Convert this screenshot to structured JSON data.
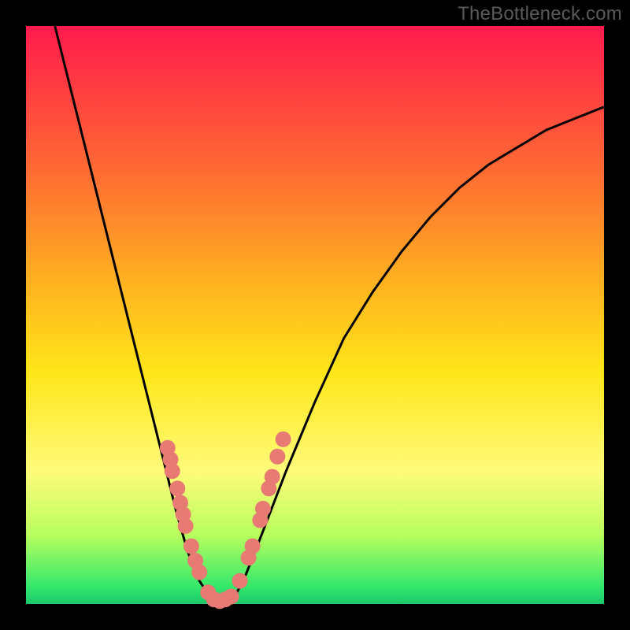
{
  "watermark": "TheBottleneck.com",
  "chart_data": {
    "type": "line",
    "title": "",
    "xlabel": "",
    "ylabel": "",
    "xlim": [
      0,
      100
    ],
    "ylim": [
      0,
      100
    ],
    "annotations": [],
    "curve": {
      "description": "V-shaped bottleneck curve; minimum (optimal match) at roughly x≈33 where y≈0; steep on the left, shallower asymptotic rise on the right",
      "x": [
        5,
        10,
        15,
        20,
        22,
        24,
        26,
        28,
        30,
        32,
        34,
        36,
        38,
        40,
        45,
        50,
        55,
        60,
        65,
        70,
        75,
        80,
        85,
        90,
        95,
        100
      ],
      "y": [
        100,
        80,
        60,
        40,
        32,
        24,
        16,
        9,
        4,
        1,
        0,
        1,
        5,
        10,
        23,
        35,
        46,
        54,
        61,
        67,
        72,
        76,
        79,
        82,
        84,
        86
      ]
    },
    "markers": {
      "description": "salmon dots clustered on both arms near the bottom of the V",
      "points": [
        {
          "x": 24.5,
          "y": 27
        },
        {
          "x": 25.0,
          "y": 25
        },
        {
          "x": 25.3,
          "y": 23
        },
        {
          "x": 26.2,
          "y": 20
        },
        {
          "x": 26.7,
          "y": 17.5
        },
        {
          "x": 27.2,
          "y": 15.5
        },
        {
          "x": 27.6,
          "y": 13.5
        },
        {
          "x": 28.6,
          "y": 10
        },
        {
          "x": 29.3,
          "y": 7.5
        },
        {
          "x": 30.0,
          "y": 5.5
        },
        {
          "x": 31.5,
          "y": 2.0
        },
        {
          "x": 32.5,
          "y": 0.8
        },
        {
          "x": 33.5,
          "y": 0.5
        },
        {
          "x": 34.5,
          "y": 0.8
        },
        {
          "x": 35.5,
          "y": 1.3
        },
        {
          "x": 37.0,
          "y": 4.0
        },
        {
          "x": 38.5,
          "y": 8.0
        },
        {
          "x": 39.2,
          "y": 10
        },
        {
          "x": 40.5,
          "y": 14.5
        },
        {
          "x": 41.0,
          "y": 16.5
        },
        {
          "x": 42.0,
          "y": 20.0
        },
        {
          "x": 42.6,
          "y": 22.0
        },
        {
          "x": 43.5,
          "y": 25.5
        },
        {
          "x": 44.5,
          "y": 28.5
        }
      ],
      "color": "#e77b74",
      "radius": 10
    },
    "gradient_bands": [
      {
        "color": "#ff1a4d",
        "stop": 0
      },
      {
        "color": "#ffe61a",
        "stop": 60
      },
      {
        "color": "#1bc769",
        "stop": 100
      }
    ]
  }
}
